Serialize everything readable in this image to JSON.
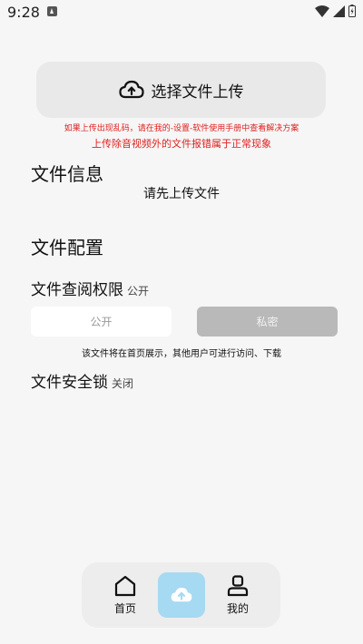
{
  "status_bar": {
    "time": "9:28"
  },
  "upload": {
    "label": "选择文件上传",
    "icon": "cloud-upload-icon",
    "warning_small": "如果上传出现乱码，请在我的-设置-软件使用手册中查看解决方案",
    "warning_large": "上传除音视频外的文件报错属于正常现象"
  },
  "file_info": {
    "title": "文件信息",
    "empty_text": "请先上传文件"
  },
  "file_config": {
    "title": "文件配置",
    "permission": {
      "label": "文件查阅权限",
      "current": "公开",
      "options": [
        "公开",
        "私密"
      ],
      "description": "该文件将在首页展示，其他用户可进行访问、下载"
    },
    "security_lock": {
      "label": "文件安全锁",
      "state": "关闭"
    }
  },
  "bottom_nav": {
    "items": [
      {
        "label": "首页",
        "icon": "home-icon"
      },
      {
        "label": "",
        "icon": "cloud-upload-icon"
      },
      {
        "label": "我的",
        "icon": "person-icon"
      }
    ]
  },
  "colors": {
    "background": "#f6f6f6",
    "warning": "#e02020",
    "upload_active": "#a6d9f2",
    "selected_segment": "#b9b9b9"
  }
}
